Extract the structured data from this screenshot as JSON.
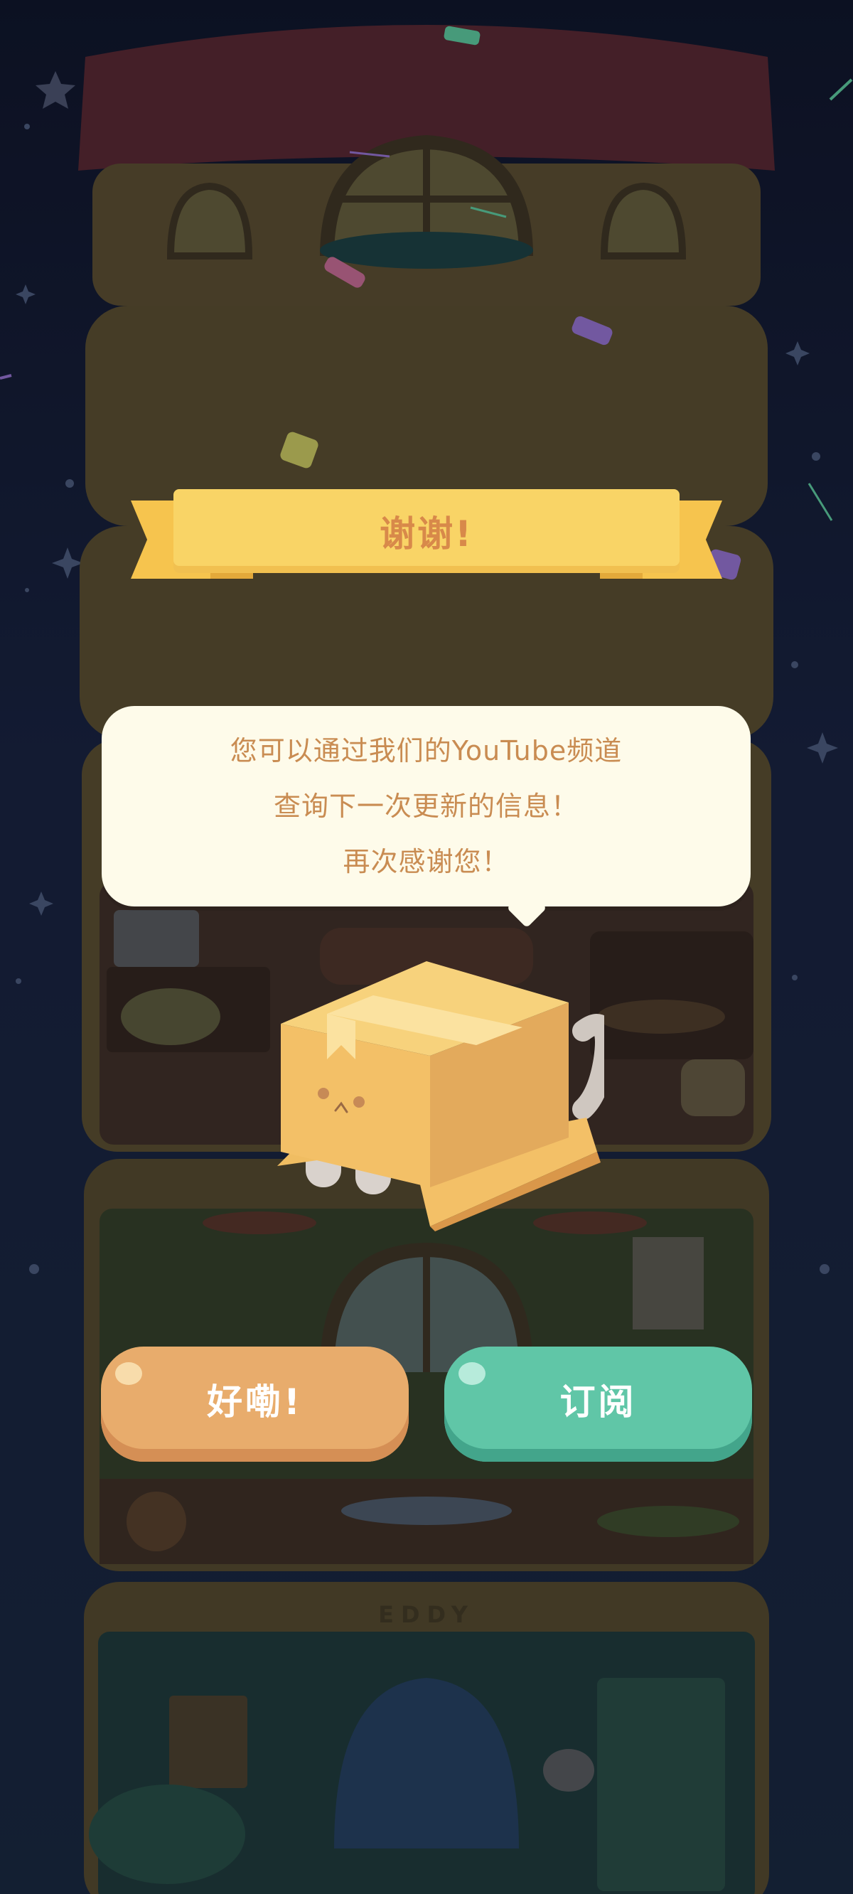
{
  "background": {
    "house_sign": "EDDY"
  },
  "banner": {
    "title": "谢谢!"
  },
  "dialog": {
    "lines": [
      "您可以通过我们的YouTube频道",
      "查询下一次更新的信息！",
      "再次感谢您！"
    ]
  },
  "buttons": {
    "ok": {
      "label": "好嘞!"
    },
    "subscribe": {
      "label": "订阅"
    }
  },
  "colors": {
    "banner": "#f9d466",
    "banner_text": "#d8894a",
    "bubble_bg": "#fefbea",
    "bubble_text": "#c98c52",
    "ok_button": "#e8ac6c",
    "subscribe_button": "#60c6a7"
  }
}
